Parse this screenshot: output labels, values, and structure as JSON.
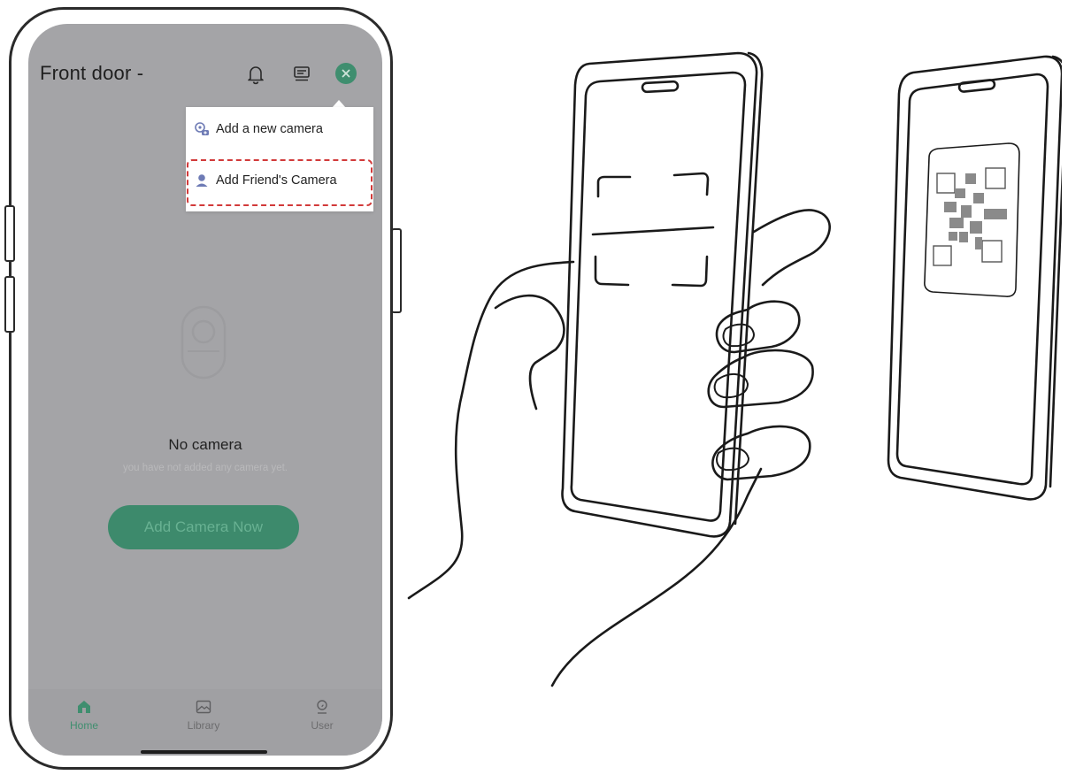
{
  "header": {
    "title": "Front door -"
  },
  "menu": {
    "items": [
      {
        "label": "Add a new camera",
        "icon": "camera-add-icon"
      },
      {
        "label": "Add Friend's Camera",
        "icon": "person-icon"
      }
    ]
  },
  "empty_state": {
    "title": "No camera",
    "subtitle": "you have not added any camera yet.",
    "button": "Add Camera Now"
  },
  "tabs": [
    {
      "label": "Home",
      "icon": "home-icon",
      "active": true
    },
    {
      "label": "Library",
      "icon": "image-icon",
      "active": false
    },
    {
      "label": "User",
      "icon": "user-icon",
      "active": false
    }
  ],
  "colors": {
    "accent": "#3f8e6f",
    "highlight_border": "#d23a3a",
    "overlay": "#a4a4a7"
  }
}
